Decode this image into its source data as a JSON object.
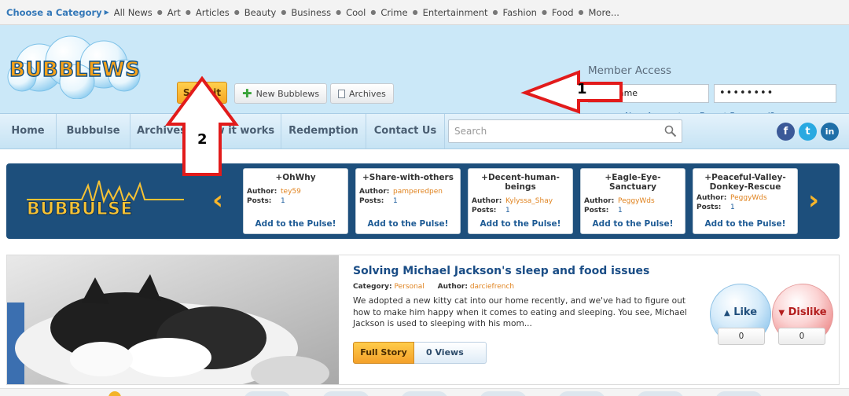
{
  "catbar": {
    "label": "Choose a Category",
    "items": [
      "All News",
      "Art",
      "Articles",
      "Beauty",
      "Business",
      "Cool",
      "Crime",
      "Entertainment",
      "Fashion",
      "Food",
      "More..."
    ]
  },
  "header": {
    "logo_text": "BUBBLEWS",
    "submit_label": "Submit",
    "new_bubblews_label": "New Bubblews",
    "archives_label": "Archives"
  },
  "member": {
    "title": "Member Access",
    "username_value": "Username",
    "password_value": "••••••••",
    "new_account": "New Account",
    "dash": "-",
    "forgot_password": "Forgot Password?"
  },
  "nav": {
    "items": [
      "Home",
      "Bubbulse",
      "Archives",
      "How it works",
      "Redemption",
      "Contact Us"
    ],
    "search_placeholder": "Search",
    "social": [
      "f",
      "t",
      "in"
    ]
  },
  "pulse": {
    "logo_text": "BUBBULSE",
    "prev": "‹",
    "next": "›",
    "author_key": "Author:",
    "posts_key": "Posts:",
    "add_label": "Add to the Pulse!",
    "cards": [
      {
        "title": "+OhWhy",
        "author": "tey59",
        "posts": "1"
      },
      {
        "title": "+Share-with-others",
        "author": "pamperedpen",
        "posts": "1"
      },
      {
        "title": "+Decent-human-beings",
        "author": "Kylyssa_Shay",
        "posts": "1"
      },
      {
        "title": "+Eagle-Eye-Sanctuary",
        "author": "PeggyWds",
        "posts": "1"
      },
      {
        "title": "+Peaceful-Valley-Donkey-Rescue",
        "author": "PeggyWds",
        "posts": "1"
      }
    ]
  },
  "story": {
    "title": "Solving Michael Jackson's sleep and food issues",
    "category_key": "Category:",
    "category": "Personal",
    "author_key": "Author:",
    "author": "darciefrench",
    "text": "We adopted a new kitty cat into our home recently, and we've had to figure out how to make him happy when it comes to eating and sleeping. You see, Michael Jackson is used to sleeping with his mom...",
    "full_story_label": "Full Story",
    "views_label": "0 Views",
    "like_label": "Like",
    "dislike_label": "Dislike",
    "like_count": "0",
    "dislike_count": "0"
  },
  "annotations": {
    "arrow1_number": "1",
    "arrow2_number": "2"
  },
  "colors": {
    "header_bg": "#cbe8f8",
    "submit": "#f6a623",
    "pulse_band": "#1d4f7c",
    "link": "#346fa6",
    "accent_orange": "#e0831f"
  }
}
